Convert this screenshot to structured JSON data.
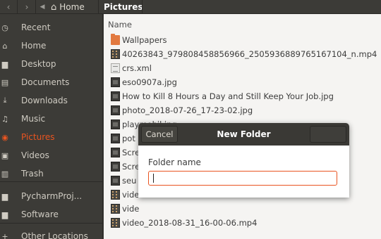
{
  "topbar": {
    "back_icon": "chevron-left-icon",
    "forward_icon": "chevron-right-icon",
    "up_icon": "caret-left-icon",
    "home_label": "Home",
    "current_label": "Pictures"
  },
  "sidebar": {
    "items": [
      {
        "label": "Recent",
        "icon": "clock-icon",
        "glyph": "◷",
        "active": false
      },
      {
        "label": "Home",
        "icon": "home-icon",
        "glyph": "⌂",
        "active": false
      },
      {
        "label": "Desktop",
        "icon": "folder-icon",
        "glyph": "▆",
        "active": false
      },
      {
        "label": "Documents",
        "icon": "document-icon",
        "glyph": "▤",
        "active": false
      },
      {
        "label": "Downloads",
        "icon": "download-icon",
        "glyph": "⤓",
        "active": false
      },
      {
        "label": "Music",
        "icon": "music-icon",
        "glyph": "♫",
        "active": false
      },
      {
        "label": "Pictures",
        "icon": "camera-icon",
        "glyph": "◉",
        "active": true
      },
      {
        "label": "Videos",
        "icon": "film-icon",
        "glyph": "▣",
        "active": false
      },
      {
        "label": "Trash",
        "icon": "trash-icon",
        "glyph": "▥",
        "active": false
      },
      {
        "label": "PycharmProj...",
        "icon": "folder-icon",
        "glyph": "▆",
        "active": false
      },
      {
        "label": "Software",
        "icon": "folder-icon",
        "glyph": "▆",
        "active": false
      },
      {
        "label": "Other Locations",
        "icon": "plus-icon",
        "glyph": "+",
        "active": false
      }
    ],
    "accent_color": "#e95420"
  },
  "main": {
    "column_name": "Name",
    "files": [
      {
        "name": "Wallpapers",
        "type": "folder"
      },
      {
        "name": "40263843_979808458856966_2505936889765167104_n.mp4",
        "type": "video"
      },
      {
        "name": "crs.xml",
        "type": "text"
      },
      {
        "name": "eso0907a.jpg",
        "type": "image"
      },
      {
        "name": "How to Kill 8 Hours a Day and Still Keep Your Job.jpg",
        "type": "image"
      },
      {
        "name": "photo_2018-07-26_17-23-02.jpg",
        "type": "image"
      },
      {
        "name": "playmobil.jpg",
        "type": "image"
      },
      {
        "name": "pot",
        "type": "image"
      },
      {
        "name": "Scre",
        "type": "image"
      },
      {
        "name": "Scre",
        "type": "image"
      },
      {
        "name": "seu",
        "type": "image"
      },
      {
        "name": "vide",
        "type": "video"
      },
      {
        "name": "vide",
        "type": "video"
      },
      {
        "name": "video_2018-08-31_16-00-06.mp4",
        "type": "video"
      }
    ]
  },
  "dialog": {
    "cancel_label": "Cancel",
    "title": "New Folder",
    "field_label": "Folder name",
    "field_value": ""
  }
}
